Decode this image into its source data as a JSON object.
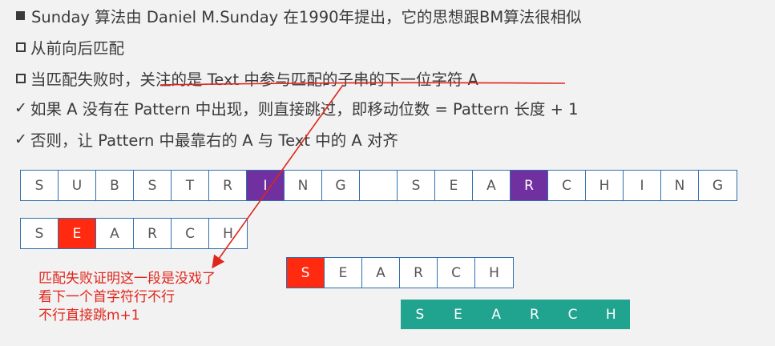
{
  "bullets": [
    {
      "type": "square",
      "text": "Sunday 算法由 Daniel M.Sunday 在1990年提出，它的思想跟BM算法很相似"
    },
    {
      "type": "box",
      "text": "从前向后匹配"
    },
    {
      "type": "box",
      "text": "当匹配失败时，关注的是 Text 中参与匹配的子串的下一位字符 A"
    },
    {
      "type": "check",
      "text": "如果 A 没有在 Pattern 中出现，则直接跳过，即移动位数 = Pattern 长度 + 1"
    },
    {
      "type": "check",
      "text": "否则，让 Pattern 中最靠右的 A 与 Text 中的 A 对齐"
    }
  ],
  "check_glyph": "✓",
  "text_row": [
    "S",
    "U",
    "B",
    "S",
    "T",
    "R",
    "I",
    "N",
    "G",
    "",
    "S",
    "E",
    "A",
    "R",
    "C",
    "H",
    "I",
    "N",
    "G"
  ],
  "text_highlight": {
    "6": "purple",
    "13": "purple"
  },
  "pattern_row1": [
    "S",
    "E",
    "A",
    "R",
    "C",
    "H"
  ],
  "pattern_row1_highlight": {
    "1": "red"
  },
  "pattern_row2": [
    "S",
    "E",
    "A",
    "R",
    "C",
    "H"
  ],
  "pattern_row2_highlight": {
    "0": "red"
  },
  "pattern_row3": [
    "S",
    "E",
    "A",
    "R",
    "C",
    "H"
  ],
  "annotation": [
    "匹配失败证明这一段是没戏了",
    "看下一个首字符行不行",
    "不行直接跳m+1"
  ],
  "colors": {
    "purple": "#7030a0",
    "red": "#ff2a10",
    "teal": "#20a38f",
    "border": "#2f6fb0",
    "annotation": "#e0251b"
  }
}
